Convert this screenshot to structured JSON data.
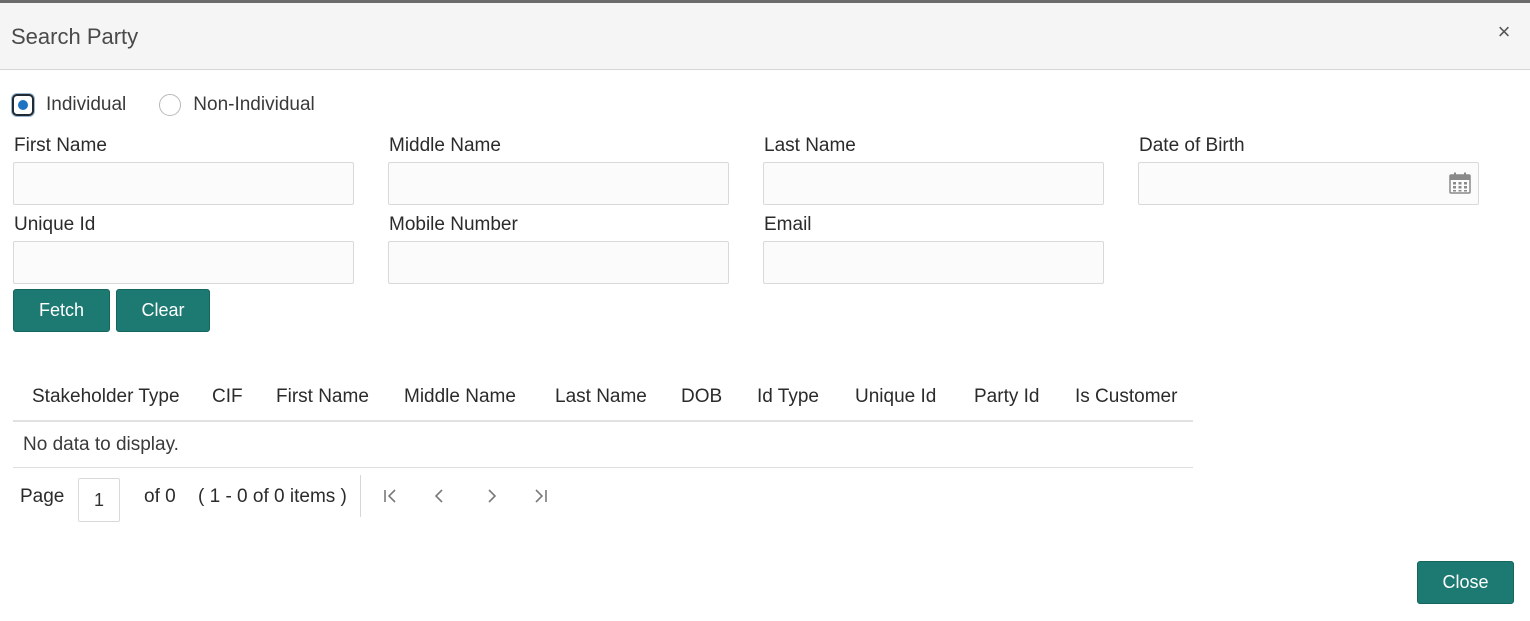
{
  "dialog": {
    "title": "Search Party",
    "close_glyph": "×"
  },
  "party_type": {
    "options": [
      {
        "label": "Individual",
        "checked": true
      },
      {
        "label": "Non-Individual",
        "checked": false
      }
    ]
  },
  "fields": {
    "first_name": {
      "label": "First Name",
      "value": ""
    },
    "middle_name": {
      "label": "Middle Name",
      "value": ""
    },
    "last_name": {
      "label": "Last Name",
      "value": ""
    },
    "date_of_birth": {
      "label": "Date of Birth",
      "value": ""
    },
    "unique_id": {
      "label": "Unique Id",
      "value": ""
    },
    "mobile_number": {
      "label": "Mobile Number",
      "value": ""
    },
    "email": {
      "label": "Email",
      "value": ""
    }
  },
  "actions": {
    "fetch_label": "Fetch",
    "clear_label": "Clear",
    "close_label": "Close"
  },
  "results": {
    "columns": [
      "Stakeholder Type",
      "CIF",
      "First Name",
      "Middle Name",
      "Last Name",
      "DOB",
      "Id Type",
      "Unique Id",
      "Party Id",
      "Is Customer"
    ],
    "rows": [],
    "empty_message": "No data to display."
  },
  "pagination": {
    "page_label": "Page",
    "current_page": "1",
    "of_label": "of 0",
    "range_label": "( 1 - 0 of 0 items )"
  },
  "icons": {
    "close": "close-icon",
    "calendar": "calendar-icon",
    "first": "first-page-icon",
    "prev": "previous-page-icon",
    "next": "next-page-icon",
    "last": "last-page-icon"
  },
  "colors": {
    "primary_button": "#1c7a72",
    "radio_selected": "#1d73c2",
    "header_bg": "#f5f5f5"
  }
}
